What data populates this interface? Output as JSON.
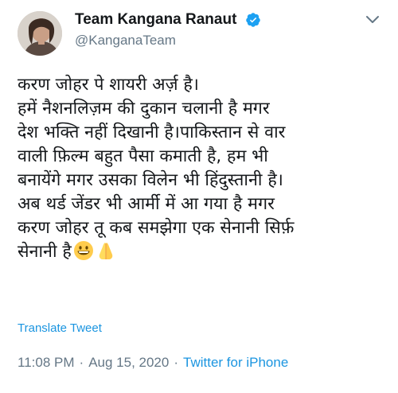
{
  "author": {
    "display_name": "Team Kangana Ranaut",
    "handle": "@KanganaTeam",
    "avatar_icon": "profile-photo",
    "verified_icon": "verified-badge-icon"
  },
  "tweet": {
    "lines": [
      "करण जोहर पे शायरी अर्ज़ है।",
      "हमें नैशनलिज़म की दुकान चलानी है मगर",
      "देश भक्ति नहीं दिखानी है।पाकिस्तान से वार",
      "वाली फ़िल्म बहुत पैसा कमाती है, हम भी",
      "बनायेंगे मगर उसका विलेन भी हिंदुस्तानी है।",
      "अब थर्ड जेंडर भी आर्मी में आ गया है मगर",
      "करण जोहर तू कब समझेगा एक सेनानी सिर्फ़",
      "सेनानी है"
    ],
    "emojis": [
      "grinning-face-emoji",
      "folded-hands-emoji"
    ]
  },
  "translate_label": "Translate Tweet",
  "meta": {
    "time": "11:08 PM",
    "separator": "·",
    "date": "Aug 15, 2020",
    "source": "Twitter for iPhone"
  },
  "colors": {
    "verified": "#1da1f2",
    "link": "#1b95e0",
    "muted": "#657786",
    "text": "#14171a"
  }
}
